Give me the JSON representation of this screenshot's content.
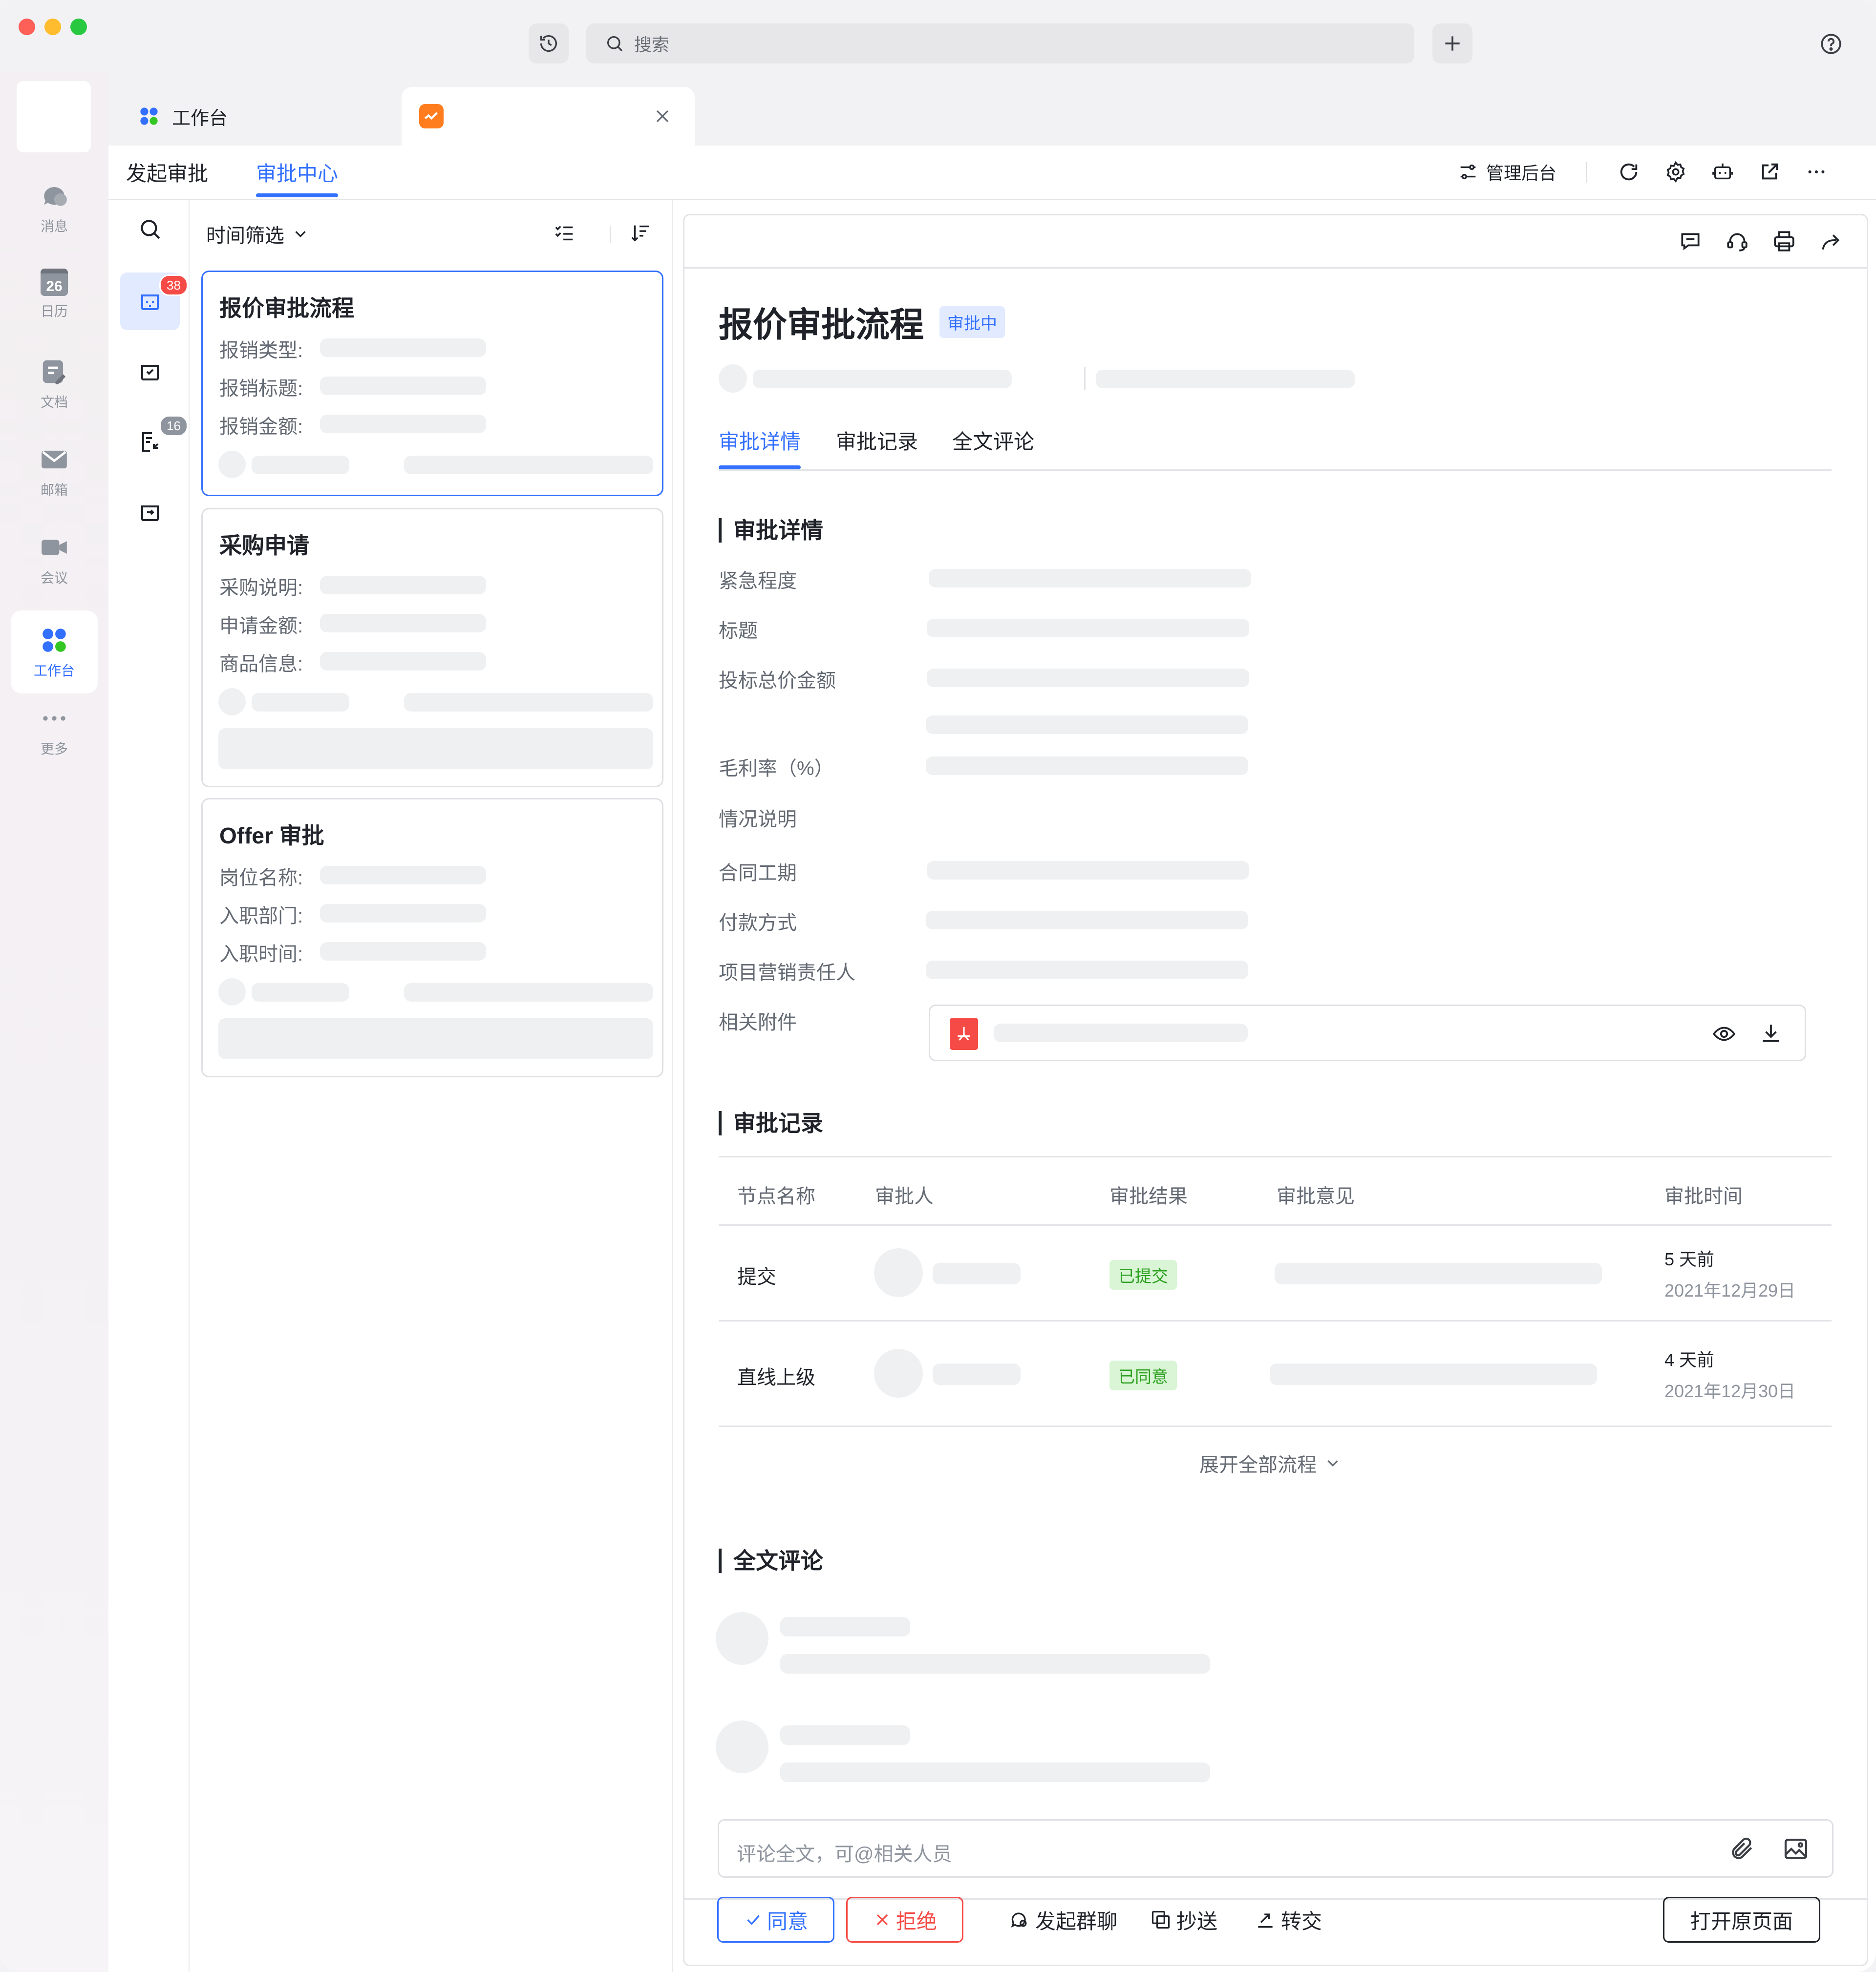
{
  "titlebar": {
    "search_placeholder": "搜索"
  },
  "rail": {
    "items": [
      {
        "label": "消息",
        "icon": "chat-icon"
      },
      {
        "label": "日历",
        "icon": "calendar-icon",
        "icon_text": "26"
      },
      {
        "label": "文档",
        "icon": "docs-icon"
      },
      {
        "label": "邮箱",
        "icon": "mail-icon"
      },
      {
        "label": "会议",
        "icon": "video-icon"
      },
      {
        "label": "工作台",
        "icon": "workplace-icon",
        "active": true
      },
      {
        "label": "更多",
        "icon": "more-icon"
      }
    ]
  },
  "tabs": [
    {
      "label": "工作台",
      "icon": "workplace-icon"
    },
    {
      "label": "",
      "icon": "approval-app-icon",
      "active": true
    }
  ],
  "subnav": {
    "tab_initiate": "发起审批",
    "tab_center": "审批中心",
    "admin_label": "管理后台"
  },
  "side": {
    "badge_pending": "38",
    "badge_cc": "16"
  },
  "list": {
    "filter_label": "时间筛选",
    "cards": [
      {
        "title": "报价审批流程",
        "fields": [
          "报销类型:",
          "报销标题:",
          "报销金额:"
        ]
      },
      {
        "title": "采购申请",
        "fields": [
          "采购说明:",
          "申请金额:",
          "商品信息:"
        ]
      },
      {
        "title": "Offer 审批",
        "fields": [
          "岗位名称:",
          "入职部门:",
          "入职时间:"
        ]
      }
    ]
  },
  "detail": {
    "title": "报价审批流程",
    "status": "审批中",
    "tabs": [
      "审批详情",
      "审批记录",
      "全文评论"
    ],
    "section_detail": "审批详情",
    "fields": [
      "紧急程度",
      "标题",
      "投标总价金额",
      "毛利率（%）",
      "情况说明",
      "合同工期",
      "付款方式",
      "项目营销责任人",
      "相关附件"
    ],
    "section_records": "审批记录",
    "table": {
      "headers": [
        "节点名称",
        "审批人",
        "审批结果",
        "审批意见",
        "审批时间"
      ],
      "rows": [
        {
          "node": "提交",
          "result": "已提交",
          "time_rel": "5 天前",
          "time_abs": "2021年12月29日"
        },
        {
          "node": "直线上级",
          "result": "已同意",
          "time_rel": "4 天前",
          "time_abs": "2021年12月30日"
        }
      ],
      "expand_label": "展开全部流程"
    },
    "section_comments": "全文评论",
    "comment_placeholder": "评论全文，可@相关人员",
    "actions": {
      "agree": "同意",
      "reject": "拒绝",
      "group_chat": "发起群聊",
      "cc": "抄送",
      "transfer": "转交",
      "open_original": "打开原页面"
    }
  },
  "colors": {
    "accent": "#3370ff",
    "danger": "#f54a45",
    "success": "#2ea121"
  }
}
